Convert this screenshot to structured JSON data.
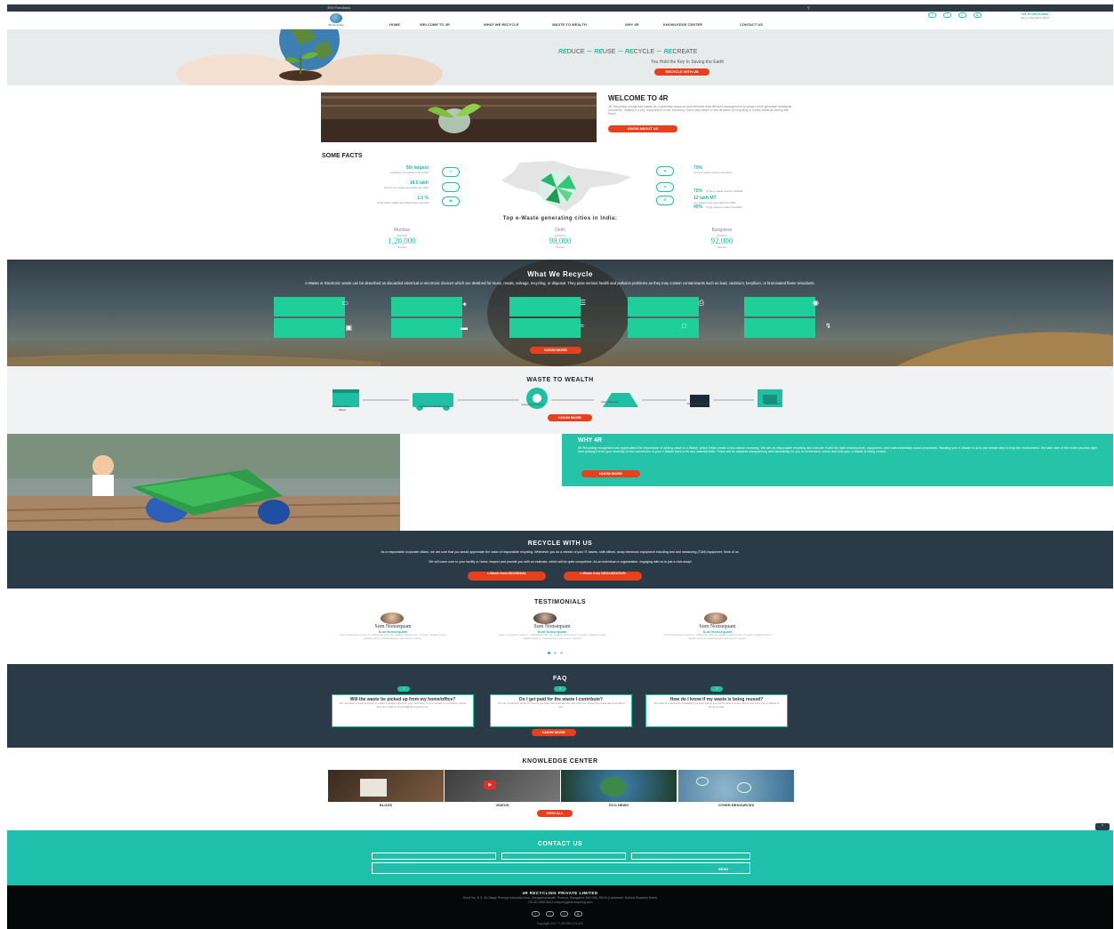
{
  "topbar": {
    "left_text": "4R4 Feedback",
    "search_icon": "search-icon"
  },
  "nav": {
    "logo_text": "4R Recycling",
    "items": [
      "HOME",
      "WELCOME TO 4R",
      "WHAT WE RECYCLE",
      "WASTE TO WEALTH",
      "WHY 4R",
      "KNOWLEDGE CENTER",
      "CONTACT US"
    ],
    "social": [
      "facebook-icon",
      "twitter-icon",
      "linkedin-icon",
      "youtube-icon"
    ],
    "phone": "+91 97454 63666",
    "phone_sub": "Mon to Sat 9AM to 6PM",
    "colors": {
      "accent": "#1fbfa4",
      "cta": "#e8401c",
      "dark": "#2b3a47"
    }
  },
  "hero": {
    "words": [
      {
        "hi": "RE",
        "rest": "DUCE"
      },
      {
        "hi": "RE",
        "rest": "USE"
      },
      {
        "hi": "RE",
        "rest": "CYCLE"
      },
      {
        "hi": "RE",
        "rest": "CREATE"
      }
    ],
    "tagline": "You Hold the Key to Saving the Earth",
    "cta": "RECYCLE WITH US"
  },
  "welcome": {
    "title": "WELCOME TO 4R",
    "body": "4R Recycling recognises waste as a potential resource and believes that efficient management of waste could generate additional resources, making it a key component of our economy. Each step taken in the direction of recycling is a step towards saving the Earth.",
    "cta": "KNOW ABOUT US"
  },
  "facts": {
    "title": "SOME FACTS",
    "left": [
      {
        "value": "5th largest",
        "desc": "producer of e-waste in the world"
      },
      {
        "value": "18.5 lakh",
        "desc": "tonnes of e-waste generated annually"
      },
      {
        "value": "1.5 %",
        "desc": "of the total e-waste generated gets recycled"
      }
    ],
    "right": [
      {
        "value": "70%",
        "desc": "of the e-waste is from computers"
      },
      {
        "value": "70%",
        "desc": "of the e-waste found in landfills",
        "value2": "40%",
        "desc2": "of the heavy metals in landfills"
      },
      {
        "value": "12 lakh MT",
        "desc": "of e-waste to be generated by 2020"
      }
    ],
    "left_icons": [
      "percent-icon",
      "gauge-icon",
      "eye-icon"
    ],
    "right_icons": [
      "chart-icon",
      "drop-icon",
      "recycle-icon"
    ],
    "cities_title": "Top e-Waste generating cities in India:",
    "cities": [
      {
        "name": "Mumbai",
        "value": "1,20,000",
        "unit": "Tonnes"
      },
      {
        "name": "Delhi",
        "value": "98,000",
        "unit": "Tonnes"
      },
      {
        "name": "Bangalore",
        "value": "92,000",
        "unit": "Tonnes"
      }
    ]
  },
  "recycle": {
    "title": "What We Recycle",
    "body": "e-Waste or Electronic waste can be described as discarded electrical or electronic devices which are destined for reuse, resale, salvage, recycling, or disposal. They pose serious health and pollution problems as they may contain contaminants such as lead, cadmium, beryllium, or brominated flame retardants.",
    "tile_icons": [
      "monitor-icon",
      "mouse-icon",
      "keyboard-icon",
      "printer-icon",
      "phone-icon",
      "router-icon",
      "ac-icon",
      "cable-icon",
      "laptop-icon",
      "plug-icon"
    ],
    "cta": "KNOW MORE"
  },
  "w2w": {
    "title": "WASTE TO WEALTH",
    "steps": [
      "Collection from e-Waste",
      "Transport to 4R Recycling",
      "Recycling Process",
      "Raw Materials",
      "Ready to Re-Store",
      "New Product"
    ],
    "cta": "KNOW MORE"
  },
  "why": {
    "title": "WHY 4R",
    "body": "4R Recycling recognised and appreciated the importance of adding value to e-Waste, which helps create a low-carbon economy. We aim at responsible recycling and execute it with the right infrastructure, equipment, and environmentally sound processes. Handing your e-Waste to us is one simple step to help the environment. We take care of the entire process right from picking it from your doorstep to the conversion of your e-Waste back to its raw material state. There will be absolute transparency and traceability for you to understand where and how your e-Waste is being reused.",
    "cta": "KNOW MORE"
  },
  "rwu": {
    "title": "RECYCLE WITH US",
    "body1": "As a responsible corporate citizen, we are sure that you would appreciate the value of responsible recycling. Whenever you do a refresh of your IT assets, shift offices, scrap electronic equipment including test and measuring (T&M) equipment, think of us.",
    "body2": "We will come over to your facility or home, inspect and provide you with an estimate, which will be quite competitive. As an individual or organization, engaging with us is just a click away!",
    "btn1": "e-Waste from INDIVIDUAL",
    "btn2": "e-Waste from ORGANIZATION"
  },
  "testimonials": {
    "title": "TESTIMONIALS",
    "items": [
      {
        "name": "Sum Nonsequam",
        "role": "Sum Nonsequam",
        "text": "Duis consectetur quam in, sollicitudin felis vel, sagittis ullamcorper, ut quam. Aliquam porta sagittis tellus ut. Pellentesque elementum viverra."
      },
      {
        "name": "Sum Nonsequam",
        "role": "Sum Nonsequam",
        "text": "Duis consectetur quam in, sollicitudin felis vel, sagittis ullamcorper, ut quam. Aliquam porta sagittis tellus ut. Pellentesque elementum viverra."
      },
      {
        "name": "Sum Nonsequam",
        "role": "Sum Nonsequam",
        "text": "Duis consectetur quam in, sollicitudin felis vel, sagittis ullamcorper, ut quam. Aliquam porta sagittis tellus ut. Pellentesque elementum viverra."
      }
    ]
  },
  "faq": {
    "title": "FAQ",
    "items": [
      {
        "q": "Will the waste be picked up from my home/office?",
        "a": "Yes, we have prompt services to collect e-waste right from your doorstep. If your location is not listed, please write an email to recycling@4rrecycling.com."
      },
      {
        "q": "Do I get paid for the waste I contribute?",
        "a": "You can contribute either for free or get paid. We estimate the cost once we inspect the materials and inform you."
      },
      {
        "q": "How do I know if my waste is being reused?",
        "a": "We have an electronic traceability process where you will be able to know where and how your e-Waste is being reused."
      }
    ],
    "cta": "KNOW MORE"
  },
  "knowledge": {
    "title": "KNOWLEDGE CENTER",
    "items": [
      "BLOGS",
      "VIDEOS",
      "ECO NEWS",
      "OTHER RESOURCES"
    ],
    "cta": "VIEW ALL"
  },
  "contact": {
    "title": "CONTACT US",
    "send": "SEND"
  },
  "footer": {
    "company": "4R RECYCLING PRIVATE LIMITED",
    "address": "Shed No. K-5, 3A Stage Peenya Industrial Area, Nelagadranahalli, Peenya, Bangalore 560 058, INDIA (Landmark: Behind Bhadran Hotel)",
    "contacts": "+91 80 2839 6612    recycling@4rrecycling.com",
    "copyright": "Copyright 2017 © 4R RECYCLING"
  }
}
